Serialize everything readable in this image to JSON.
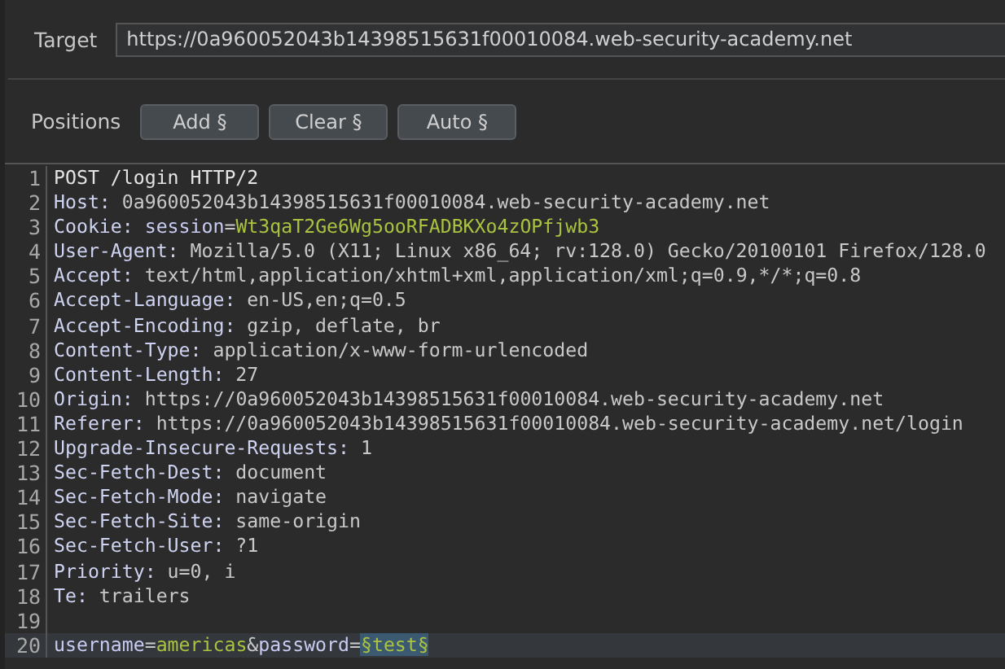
{
  "target": {
    "label": "Target",
    "value": "https://0a960052043b14398515631f00010084.web-security-academy.net"
  },
  "positions": {
    "label": "Positions",
    "buttons": [
      "Add §",
      "Clear §",
      "Auto §"
    ]
  },
  "editor": {
    "lines": [
      {
        "number": "1",
        "current": false,
        "segments": [
          {
            "kind": "plain",
            "text": "POST /login HTTP/2"
          }
        ]
      },
      {
        "number": "2",
        "current": false,
        "segments": [
          {
            "kind": "key",
            "text": "Host:"
          },
          {
            "kind": "value",
            "text": " 0a960052043b14398515631f00010084.web-security-academy.net"
          }
        ]
      },
      {
        "number": "3",
        "current": false,
        "segments": [
          {
            "kind": "key",
            "text": "Cookie: "
          },
          {
            "kind": "param",
            "text": "session"
          },
          {
            "kind": "value",
            "text": "="
          },
          {
            "kind": "green",
            "text": "Wt3qaT2Ge6Wg5ooRFADBKXo4zOPfjwb3"
          }
        ]
      },
      {
        "number": "4",
        "current": false,
        "segments": [
          {
            "kind": "key",
            "text": "User-Agent:"
          },
          {
            "kind": "value",
            "text": " Mozilla/5.0 (X11; Linux x86_64; rv:128.0) Gecko/20100101 Firefox/128.0"
          }
        ]
      },
      {
        "number": "5",
        "current": false,
        "segments": [
          {
            "kind": "key",
            "text": "Accept:"
          },
          {
            "kind": "value",
            "text": " text/html,application/xhtml+xml,application/xml;q=0.9,*/*;q=0.8"
          }
        ]
      },
      {
        "number": "6",
        "current": false,
        "segments": [
          {
            "kind": "key",
            "text": "Accept-Language:"
          },
          {
            "kind": "value",
            "text": " en-US,en;q=0.5"
          }
        ]
      },
      {
        "number": "7",
        "current": false,
        "segments": [
          {
            "kind": "key",
            "text": "Accept-Encoding:"
          },
          {
            "kind": "value",
            "text": " gzip, deflate, br"
          }
        ]
      },
      {
        "number": "8",
        "current": false,
        "segments": [
          {
            "kind": "key",
            "text": "Content-Type:"
          },
          {
            "kind": "value",
            "text": " application/x-www-form-urlencoded"
          }
        ]
      },
      {
        "number": "9",
        "current": false,
        "segments": [
          {
            "kind": "key",
            "text": "Content-Length:"
          },
          {
            "kind": "value",
            "text": " 27"
          }
        ]
      },
      {
        "number": "10",
        "current": false,
        "segments": [
          {
            "kind": "key",
            "text": "Origin:"
          },
          {
            "kind": "value",
            "text": " https://0a960052043b14398515631f00010084.web-security-academy.net"
          }
        ]
      },
      {
        "number": "11",
        "current": false,
        "segments": [
          {
            "kind": "key",
            "text": "Referer:"
          },
          {
            "kind": "value",
            "text": " https://0a960052043b14398515631f00010084.web-security-academy.net/login"
          }
        ]
      },
      {
        "number": "12",
        "current": false,
        "segments": [
          {
            "kind": "key",
            "text": "Upgrade-Insecure-Requests:"
          },
          {
            "kind": "value",
            "text": " 1"
          }
        ]
      },
      {
        "number": "13",
        "current": false,
        "segments": [
          {
            "kind": "key",
            "text": "Sec-Fetch-Dest:"
          },
          {
            "kind": "value",
            "text": " document"
          }
        ]
      },
      {
        "number": "14",
        "current": false,
        "segments": [
          {
            "kind": "key",
            "text": "Sec-Fetch-Mode:"
          },
          {
            "kind": "value",
            "text": " navigate"
          }
        ]
      },
      {
        "number": "15",
        "current": false,
        "segments": [
          {
            "kind": "key",
            "text": "Sec-Fetch-Site:"
          },
          {
            "kind": "value",
            "text": " same-origin"
          }
        ]
      },
      {
        "number": "16",
        "current": false,
        "segments": [
          {
            "kind": "key",
            "text": "Sec-Fetch-User:"
          },
          {
            "kind": "value",
            "text": " ?1"
          }
        ]
      },
      {
        "number": "17",
        "current": false,
        "segments": [
          {
            "kind": "key",
            "text": "Priority:"
          },
          {
            "kind": "value",
            "text": " u=0, i"
          }
        ]
      },
      {
        "number": "18",
        "current": false,
        "segments": [
          {
            "kind": "key",
            "text": "Te:"
          },
          {
            "kind": "value",
            "text": " trailers"
          }
        ]
      },
      {
        "number": "19",
        "current": false
      },
      {
        "number": "20",
        "current": true,
        "segments": [
          {
            "kind": "param",
            "text": "username"
          },
          {
            "kind": "value",
            "text": "="
          },
          {
            "kind": "green",
            "text": "americas"
          },
          {
            "kind": "value",
            "text": "&"
          },
          {
            "kind": "param",
            "text": "password"
          },
          {
            "kind": "value",
            "text": "="
          },
          {
            "kind": "payload",
            "text": "§test§"
          }
        ]
      }
    ]
  }
}
